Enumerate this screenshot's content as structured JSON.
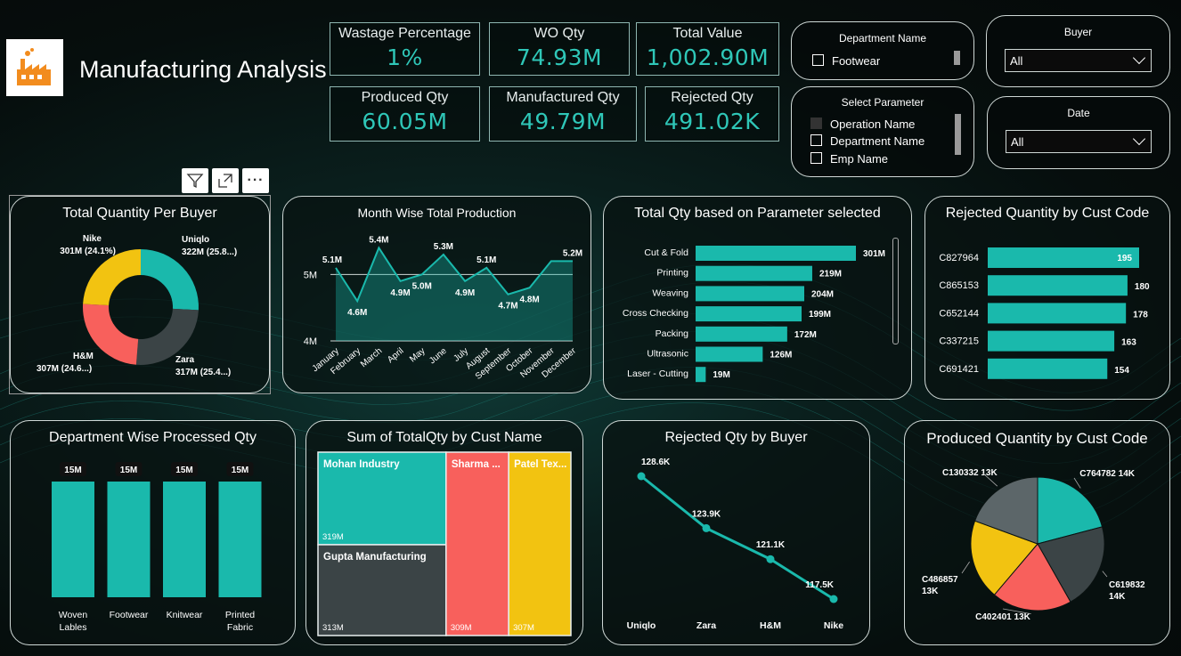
{
  "header": {
    "title": "Manufacturing Analysis",
    "logo_icon": "factory-icon"
  },
  "kpis": [
    {
      "label": "Wastage Percentage",
      "value": "1%"
    },
    {
      "label": "WO Qty",
      "value": "74.93M"
    },
    {
      "label": "Total Value",
      "value": "1,002.90M"
    },
    {
      "label": "Produced Qty",
      "value": "60.05M"
    },
    {
      "label": "Manufactured Qty",
      "value": "49.79M"
    },
    {
      "label": "Rejected Qty",
      "value": "491.02K"
    }
  ],
  "slicers": {
    "department": {
      "title": "Department Name",
      "items": [
        "Footwear"
      ]
    },
    "parameter": {
      "title": "Select Parameter",
      "items": [
        "Operation Name",
        "Department Name",
        "Emp Name"
      ]
    },
    "buyer": {
      "title": "Buyer",
      "selected": "All"
    },
    "date": {
      "title": "Date",
      "selected": "All"
    }
  },
  "visual_toolbar": {
    "filter_icon": "filter-icon",
    "focus_icon": "focus-mode-icon",
    "more_icon": "more-options-icon"
  },
  "colors": {
    "teal": "#1ab9ac",
    "dark": "#3b4446",
    "red": "#f8605c",
    "yellow": "#f2c311",
    "kpi_value": "#2fc7b8"
  },
  "chart_data": [
    {
      "id": "donut",
      "type": "pie",
      "title": "Total Quantity Per Buyer",
      "slices": [
        {
          "name": "Uniqlo",
          "value": 322,
          "label": "322M (25.8...)",
          "color": "#1ab9ac"
        },
        {
          "name": "Zara",
          "value": 317,
          "label": "317M (25.4...)",
          "color": "#3b4446"
        },
        {
          "name": "H&M",
          "value": 307,
          "label": "307M (24.6...)",
          "color": "#f8605c"
        },
        {
          "name": "Nike",
          "value": 301,
          "label": "301M (24.1%)",
          "color": "#f2c311"
        }
      ]
    },
    {
      "id": "monthly",
      "type": "area",
      "title": "Month Wise Total Production",
      "categories": [
        "January",
        "February",
        "March",
        "April",
        "May",
        "June",
        "July",
        "August",
        "September",
        "October",
        "November",
        "December"
      ],
      "values": [
        5.1,
        4.6,
        5.4,
        4.9,
        5.0,
        5.3,
        4.9,
        5.1,
        4.7,
        4.8,
        5.2,
        5.2
      ],
      "labels": [
        "5.1M",
        "4.6M",
        "5.4M",
        "4.9M",
        "5.0M",
        "5.3M",
        "4.9M",
        "5.1M",
        "4.7M",
        "4.8M",
        "",
        "5.2M"
      ],
      "yticks": [
        "5M",
        "4M"
      ],
      "ylim": [
        4,
        5.5
      ]
    },
    {
      "id": "param",
      "type": "bar",
      "title": "Total Qty based on  Parameter selected",
      "categories": [
        "Cut & Fold",
        "Printing",
        "Weaving",
        "Cross Checking",
        "Packing",
        "Ultrasonic",
        "Laser - Cutting"
      ],
      "values": [
        301,
        219,
        204,
        199,
        172,
        126,
        19
      ],
      "labels": [
        "301M",
        "219M",
        "204M",
        "199M",
        "172M",
        "126M",
        "19M"
      ]
    },
    {
      "id": "rejcust",
      "type": "bar",
      "title": "Rejected Quantity by Cust Code",
      "categories": [
        "C827964",
        "C865153",
        "C652144",
        "C337215",
        "C691421"
      ],
      "values": [
        195,
        180,
        178,
        163,
        154
      ]
    },
    {
      "id": "dept",
      "type": "bar",
      "title": "Department Wise Processed Qty",
      "categories": [
        "Woven Lables",
        "Footwear",
        "Knitwear",
        "Printed Fabric"
      ],
      "values": [
        15,
        15,
        15,
        15
      ],
      "labels": [
        "15M",
        "15M",
        "15M",
        "15M"
      ]
    },
    {
      "id": "treemap",
      "type": "treemap",
      "title": "Sum of TotalQty by Cust Name",
      "items": [
        {
          "name": "Mohan Industry",
          "label": "319M",
          "value": 319,
          "color": "#1ab9ac"
        },
        {
          "name": "Gupta Manufacturing",
          "label": "313M",
          "value": 313,
          "color": "#3b4446"
        },
        {
          "name": "Sharma ...",
          "label": "309M",
          "value": 309,
          "color": "#f8605c"
        },
        {
          "name": "Patel Tex...",
          "label": "307M",
          "value": 307,
          "color": "#f2c311"
        }
      ]
    },
    {
      "id": "rejbuyer",
      "type": "line",
      "title": "Rejected Qty by Buyer",
      "categories": [
        "Uniqlo",
        "Zara",
        "H&M",
        "Nike"
      ],
      "values": [
        128.6,
        123.9,
        121.1,
        117.5
      ],
      "labels": [
        "128.6K",
        "123.9K",
        "121.1K",
        "117.5K"
      ]
    },
    {
      "id": "pie",
      "type": "pie",
      "title": "Produced Quantity by Cust Code",
      "slices": [
        {
          "name": "C764782",
          "value": 14,
          "label": "C764782 14K",
          "color": "#1ab9ac"
        },
        {
          "name": "C619832",
          "value": 14,
          "label": "C619832 14K",
          "color": "#3b4446"
        },
        {
          "name": "C402401",
          "value": 13,
          "label": "C402401 13K",
          "color": "#f8605c"
        },
        {
          "name": "C486857",
          "value": 13,
          "label": "C486857 13K",
          "color": "#f2c311"
        },
        {
          "name": "C130332",
          "value": 13,
          "label": "C130332 13K",
          "color": "#5c6669"
        }
      ]
    }
  ]
}
